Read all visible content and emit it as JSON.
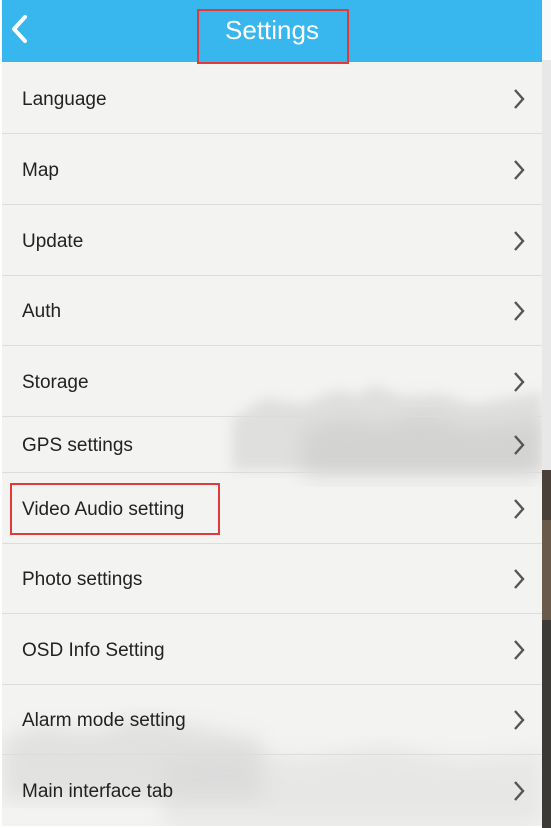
{
  "header": {
    "title": "Settings",
    "back_icon": "chevron-left-icon",
    "background": "#38b6ee"
  },
  "settings_items": [
    {
      "label": "Language"
    },
    {
      "label": "Map"
    },
    {
      "label": "Update"
    },
    {
      "label": "Auth"
    },
    {
      "label": "Storage"
    },
    {
      "label": "GPS settings"
    },
    {
      "label": "Video Audio setting",
      "highlighted": true
    },
    {
      "label": "Photo settings"
    },
    {
      "label": "OSD Info Setting"
    },
    {
      "label": "Alarm mode setting"
    },
    {
      "label": "Main interface tab"
    }
  ],
  "row_icon": "chevron-right-icon",
  "annotation_color": "#e03a3a"
}
